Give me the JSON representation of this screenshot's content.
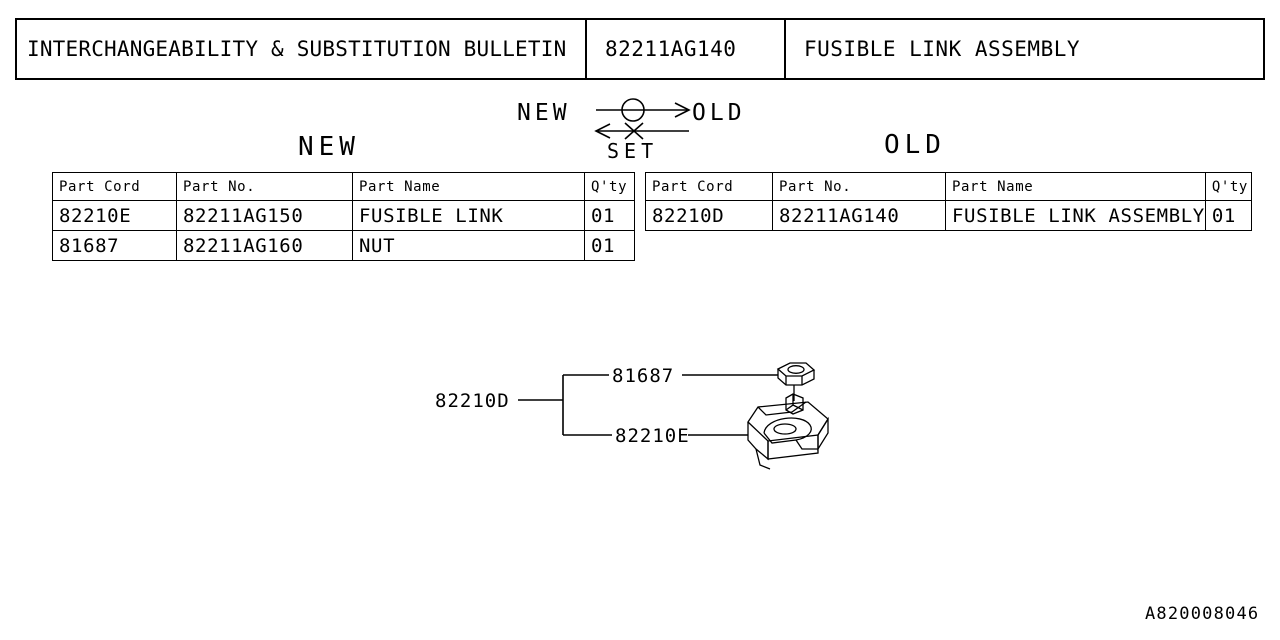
{
  "header": {
    "title": "INTERCHANGEABILITY & SUBSTITUTION BULLETIN",
    "part_no": "82211AG140",
    "part_name": "FUSIBLE LINK ASSEMBLY"
  },
  "substitution": {
    "new_label": "NEW",
    "old_label": "OLD",
    "set_label": "SET",
    "forward_mark": "circle-symbol",
    "reverse_mark": "cross-symbol"
  },
  "captions": {
    "new": "NEW",
    "old": "OLD"
  },
  "tables": {
    "new": {
      "columns": [
        "Part Cord",
        "Part No.",
        "Part Name",
        "Q'ty"
      ],
      "rows": [
        {
          "cord": "82210E",
          "no": "82211AG150",
          "name": "FUSIBLE LINK",
          "qty": "01"
        },
        {
          "cord": "81687",
          "no": "82211AG160",
          "name": "NUT",
          "qty": "01"
        }
      ]
    },
    "old": {
      "columns": [
        "Part Cord",
        "Part No.",
        "Part Name",
        "Q'ty"
      ],
      "rows": [
        {
          "cord": "82210D",
          "no": "82211AG140",
          "name": "FUSIBLE LINK ASSEMBLY",
          "qty": "01"
        }
      ]
    }
  },
  "illustration": {
    "assembly_label": "82210D",
    "nut_label": "81687",
    "link_label": "82210E"
  },
  "footer": {
    "drawing_code": "A820008046"
  },
  "colors": {
    "ink": "#000000",
    "paper": "#ffffff"
  }
}
